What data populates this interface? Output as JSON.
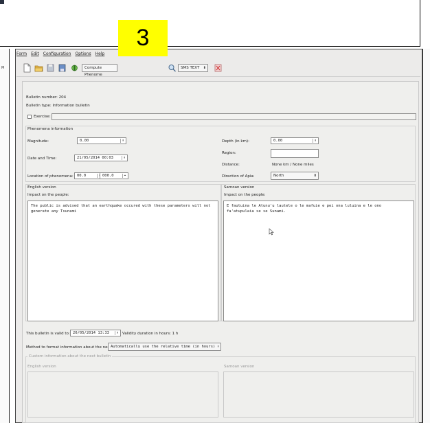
{
  "badge": "3",
  "left_panel_char": "M",
  "menu": [
    "Form",
    "Edit",
    "Configuration",
    "Options",
    "Help"
  ],
  "toolbar": {
    "compute_combo": "Compute Phenome",
    "sms_combo": "SMS TEXT",
    "icons": [
      "new-file-icon",
      "open-folder-icon",
      "save-icon",
      "save-as-icon",
      "compute-icon",
      "search-icon",
      "close-document-icon"
    ]
  },
  "bulletin": {
    "number_label": "Bulletin number: 204",
    "type_label": "Bulletin type: Information bulletin",
    "exercise_label": "Exercise:"
  },
  "phenomena": {
    "group_title": "Phenomena information",
    "magnitude_label": "Magnitude:",
    "magnitude_value": "0.00",
    "datetime_label": "Date and Time:",
    "datetime_value": "21/05/2014 00:03",
    "location_label": "Location of phenomena:",
    "lat_value": "00.0",
    "lon_value": "000.0",
    "depth_label": "Depth (in km):",
    "depth_value": "0.00",
    "region_label": "Region:",
    "region_value": "",
    "distance_label": "Distance:",
    "distance_value": "None km / None miles",
    "direction_label": "Direction of Apia:",
    "direction_value": "North"
  },
  "english": {
    "group_title": "English version",
    "impact_label": "Impact on the people:",
    "impact_text": "The public is advised that an earthquake occured with these parameters will not generate any Tsunami"
  },
  "samoan": {
    "group_title": "Samoan version",
    "impact_label": "Impact on the people:",
    "impact_text": "E fautuina le Atunu'u lautele o le mafuie e pei ona luluina e le ono fa'atupulaia se se Sunami."
  },
  "validity": {
    "valid_to_label": "This bulletin is valid to:",
    "valid_to_value": "20/05/2014 13:33",
    "duration_label": "Validity duration in hours: 1 h"
  },
  "method": {
    "label": "Method to format information about the next bulletin:",
    "value": "Automatically use the relative time (in hours)"
  },
  "custom_info": {
    "group_title": "Custom information about the next bulletin",
    "english_label": "English version",
    "samoan_label": "Samoan version"
  },
  "colors": {
    "badge_bg": "#ffff00",
    "window_bg": "#ecebea"
  }
}
